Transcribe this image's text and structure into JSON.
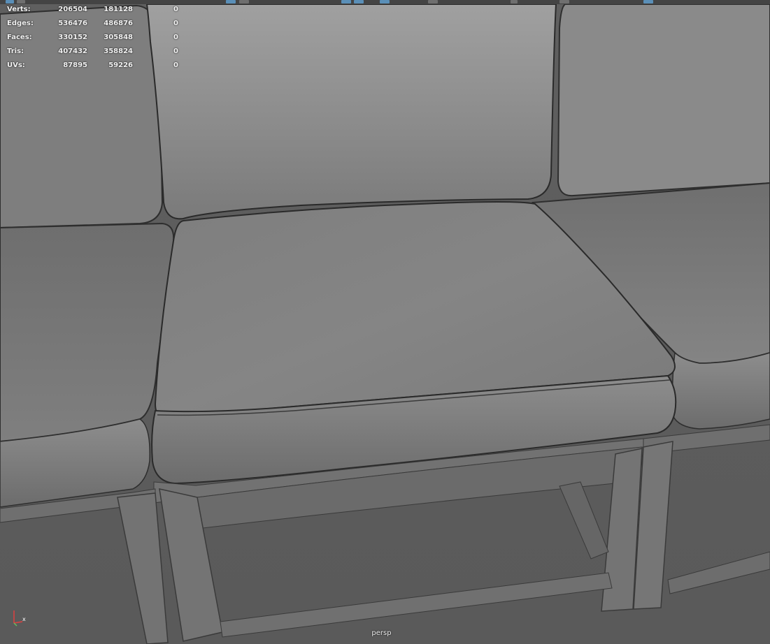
{
  "hud": {
    "rows": [
      {
        "label": "Verts:",
        "v1": "206504",
        "v2": "181128",
        "v3": "0"
      },
      {
        "label": "Edges:",
        "v1": "536476",
        "v2": "486876",
        "v3": "0"
      },
      {
        "label": "Faces:",
        "v1": "330152",
        "v2": "305848",
        "v3": "0"
      },
      {
        "label": "Tris:",
        "v1": "407432",
        "v2": "358824",
        "v3": "0"
      },
      {
        "label": "UVs:",
        "v1": "87895",
        "v2": "59226",
        "v3": "0"
      }
    ]
  },
  "viewport": {
    "camera_name": "persp",
    "axis_x_label": "x"
  },
  "colors": {
    "background": "#5a5a5a",
    "floor": "#5d5d5d",
    "cushion_light": "#909090",
    "cushion_mid": "#7a7a7a",
    "cushion_dark": "#5f5f5f",
    "frame": "#6a6a6a",
    "seam_line": "#2e2e2e",
    "axis_x": "#e04040",
    "axis_y": "#60c060"
  },
  "toolbar": {
    "icons": [
      "toolbar-icon",
      "toolbar-icon",
      "toolbar-icon",
      "toolbar-icon"
    ]
  }
}
